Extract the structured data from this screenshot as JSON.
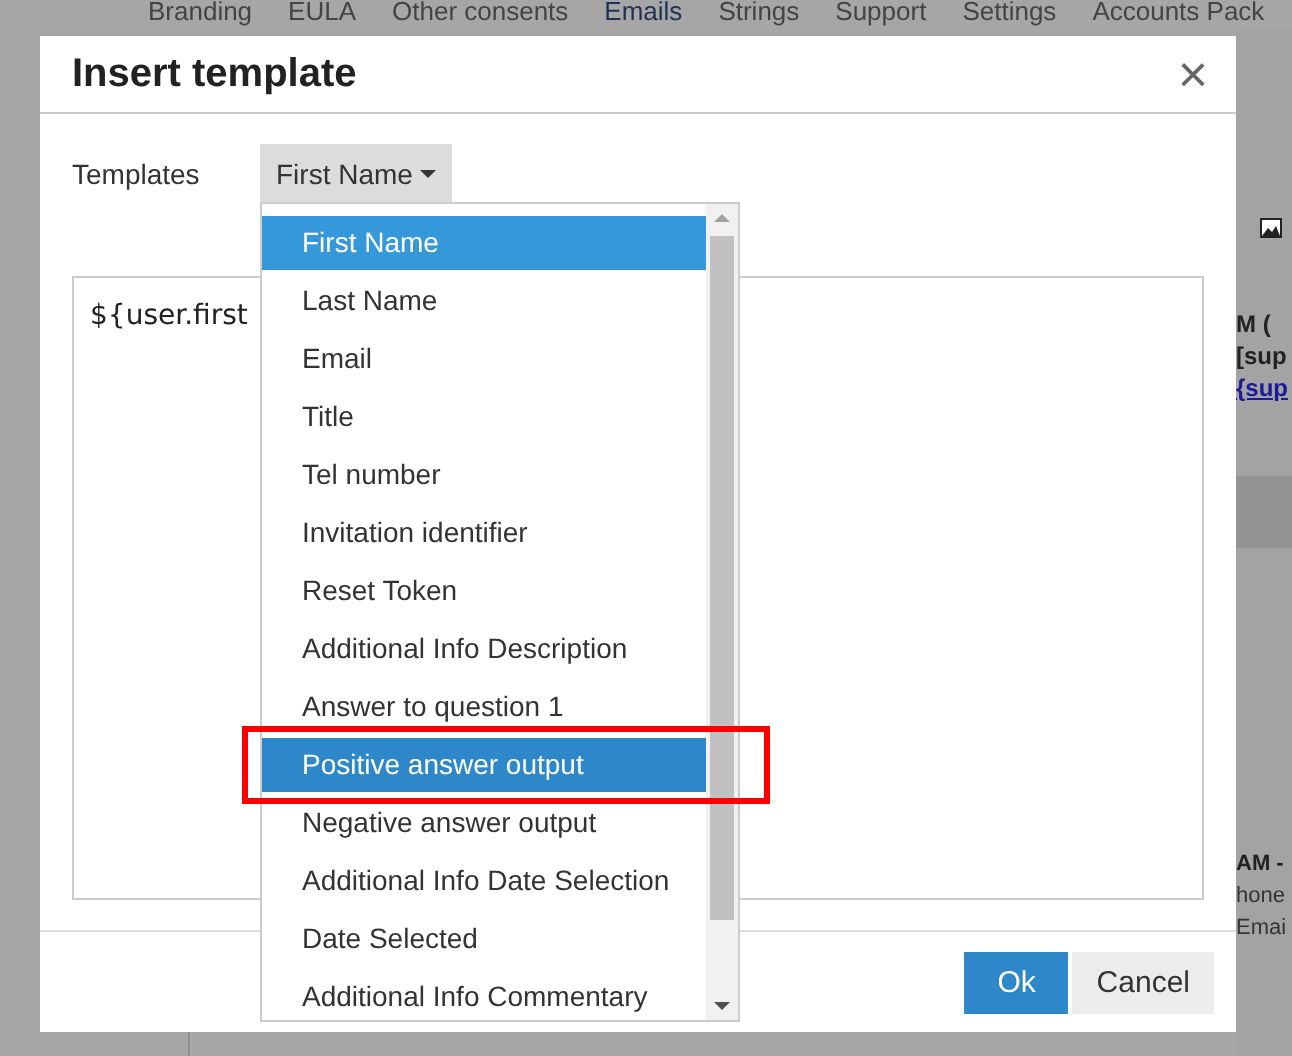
{
  "background_nav": [
    {
      "label": "Branding",
      "selected": false
    },
    {
      "label": "EULA",
      "selected": false
    },
    {
      "label": "Other consents",
      "selected": false
    },
    {
      "label": "Emails",
      "selected": true
    },
    {
      "label": "Strings",
      "selected": false
    },
    {
      "label": "Support",
      "selected": false
    },
    {
      "label": "Settings",
      "selected": false
    },
    {
      "label": "Accounts Pack",
      "selected": false
    }
  ],
  "background_fragments": [
    {
      "text": "M (",
      "kind": "bold"
    },
    {
      "text": "[sup",
      "kind": "bold"
    },
    {
      "text": "{sup",
      "kind": "link"
    },
    {
      "text": "AM -",
      "kind": "bold"
    },
    {
      "text": "hone",
      "kind": "plain"
    },
    {
      "text": "Emai",
      "kind": "plain"
    }
  ],
  "dialog": {
    "title": "Insert template",
    "close": "×",
    "templates_label": "Templates",
    "dropdown": {
      "value": "First Name",
      "expanded": true,
      "options": [
        {
          "label": "First Name",
          "selected": true,
          "hovered": false,
          "annotated": false
        },
        {
          "label": "Last Name",
          "selected": false,
          "hovered": false,
          "annotated": false
        },
        {
          "label": "Email",
          "selected": false,
          "hovered": false,
          "annotated": false
        },
        {
          "label": "Title",
          "selected": false,
          "hovered": false,
          "annotated": false
        },
        {
          "label": "Tel number",
          "selected": false,
          "hovered": false,
          "annotated": false
        },
        {
          "label": "Invitation identifier",
          "selected": false,
          "hovered": false,
          "annotated": false
        },
        {
          "label": "Reset Token",
          "selected": false,
          "hovered": false,
          "annotated": false
        },
        {
          "label": "Additional Info Description",
          "selected": false,
          "hovered": false,
          "annotated": false
        },
        {
          "label": "Answer to question 1",
          "selected": false,
          "hovered": false,
          "annotated": false
        },
        {
          "label": "Positive answer output",
          "selected": false,
          "hovered": true,
          "annotated": true
        },
        {
          "label": "Negative answer output",
          "selected": false,
          "hovered": false,
          "annotated": false
        },
        {
          "label": "Additional Info Date Selection",
          "selected": false,
          "hovered": false,
          "annotated": false
        },
        {
          "label": "Date Selected",
          "selected": false,
          "hovered": false,
          "annotated": false
        },
        {
          "label": "Additional Info Commentary",
          "selected": false,
          "hovered": false,
          "annotated": false
        }
      ]
    },
    "editor_text": "${user.first",
    "buttons": [
      {
        "label": "Ok",
        "kind": "primary"
      },
      {
        "label": "Cancel",
        "kind": "secondary"
      }
    ]
  }
}
